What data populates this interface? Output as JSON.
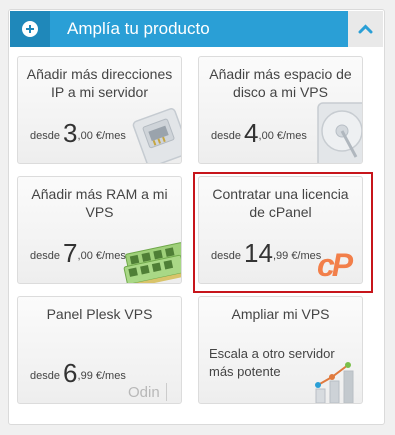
{
  "header": {
    "title": "Amplía tu producto",
    "plus_icon": "plus-circle-icon",
    "collapse_icon": "chevron-up-icon"
  },
  "products": [
    {
      "title": "Añadir más direcciones IP a mi servidor",
      "price_prefix": "desde",
      "price_int": "3",
      "price_dec": ",00 €/mes",
      "icon": "network-card-icon"
    },
    {
      "title": "Añadir más espacio de disco a mi VPS",
      "price_prefix": "desde",
      "price_int": "4",
      "price_dec": ",00 €/mes",
      "icon": "hard-disk-icon"
    },
    {
      "title": "Añadir más RAM a mi VPS",
      "price_prefix": "desde",
      "price_int": "7",
      "price_dec": ",00 €/mes",
      "icon": "ram-module-icon"
    },
    {
      "title": "Contratar una licencia de cPanel",
      "price_prefix": "desde",
      "price_int": "14",
      "price_dec": ",99 €/mes",
      "icon": "cpanel-logo",
      "logo_text": "cP"
    },
    {
      "title": "Panel Plesk VPS",
      "price_prefix": "desde",
      "price_int": "6",
      "price_dec": ",99 €/mes",
      "icon": "odin-logo",
      "logo_text": "Odin"
    },
    {
      "title": "Ampliar mi VPS",
      "description": "Escala a otro servidor más potente",
      "icon": "scale-chart-icon"
    }
  ],
  "colors": {
    "header": "#2a9fd6",
    "highlight_border": "#c7151b",
    "cpanel_orange": "#f26c2d"
  }
}
